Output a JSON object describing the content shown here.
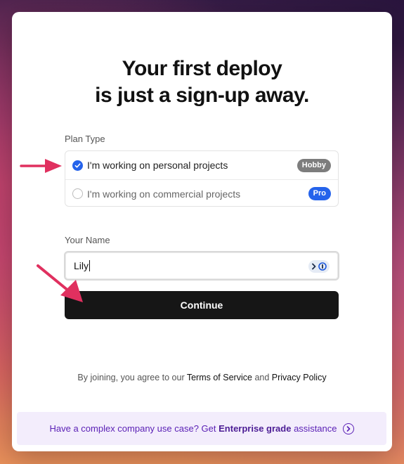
{
  "headline": {
    "line1": "Your first deploy",
    "line2": "is just a sign-up away."
  },
  "plan": {
    "label": "Plan Type",
    "options": [
      {
        "label": "I'm working on personal projects",
        "badge": "Hobby",
        "checked": true
      },
      {
        "label": "I'm working on commercial projects",
        "badge": "Pro",
        "checked": false
      }
    ]
  },
  "name": {
    "label": "Your Name",
    "value": "Lily"
  },
  "continue_label": "Continue",
  "legal": {
    "prefix": "By joining, you agree to our",
    "terms": "Terms of Service",
    "and": "and",
    "privacy": "Privacy Policy"
  },
  "enterprise": {
    "prefix": "Have a complex company use case? Get",
    "link": "Enterprise grade",
    "suffix": "assistance"
  },
  "colors": {
    "accent_blue": "#2563eb",
    "button_dark": "#161616",
    "annotation_arrow": "#e0305f",
    "enterprise_bg": "#f3edfc",
    "enterprise_text": "#5b21b6"
  }
}
